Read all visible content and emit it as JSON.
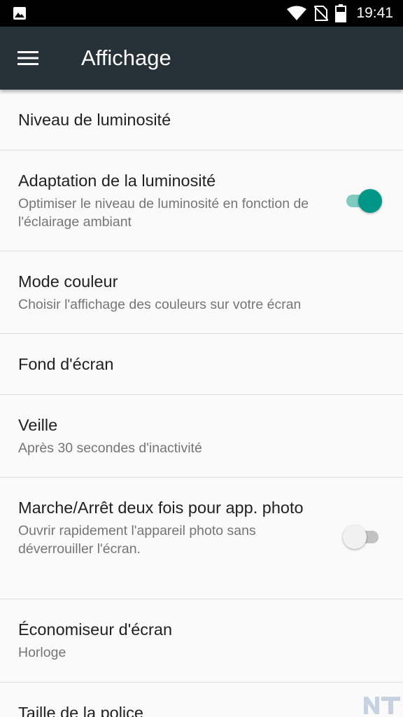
{
  "status_bar": {
    "time": "19:41",
    "left_icon": "image-notification-icon",
    "icons": [
      "wifi-icon",
      "no-sim-icon",
      "battery-icon"
    ]
  },
  "toolbar": {
    "title": "Affichage",
    "menu_icon": "hamburger-menu-icon"
  },
  "items": [
    {
      "title": "Niveau de luminosité",
      "summary": ""
    },
    {
      "title": "Adaptation de la luminosité",
      "summary": "Optimiser le niveau de luminosité en fonction de l'éclairage ambiant",
      "toggle": true
    },
    {
      "title": "Mode couleur",
      "summary": "Choisir l'affichage des couleurs sur votre écran"
    },
    {
      "title": "Fond d'écran",
      "summary": ""
    },
    {
      "title": "Veille",
      "summary": "Après 30 secondes d'inactivité"
    },
    {
      "title": "Marche/Arrêt deux fois pour app. photo",
      "summary": "Ouvrir rapidement l'appareil photo sans déverrouiller l'écran.",
      "toggle": false
    },
    {
      "title": "Économiseur d'écran",
      "summary": "Horloge"
    },
    {
      "title": "Taille de la police",
      "summary": ""
    }
  ],
  "colors": {
    "toolbar": "#263238",
    "status_bar": "#000000",
    "accent": "#009688",
    "background": "#fafafa"
  },
  "watermark": {
    "icon": "nt-logo-icon"
  }
}
